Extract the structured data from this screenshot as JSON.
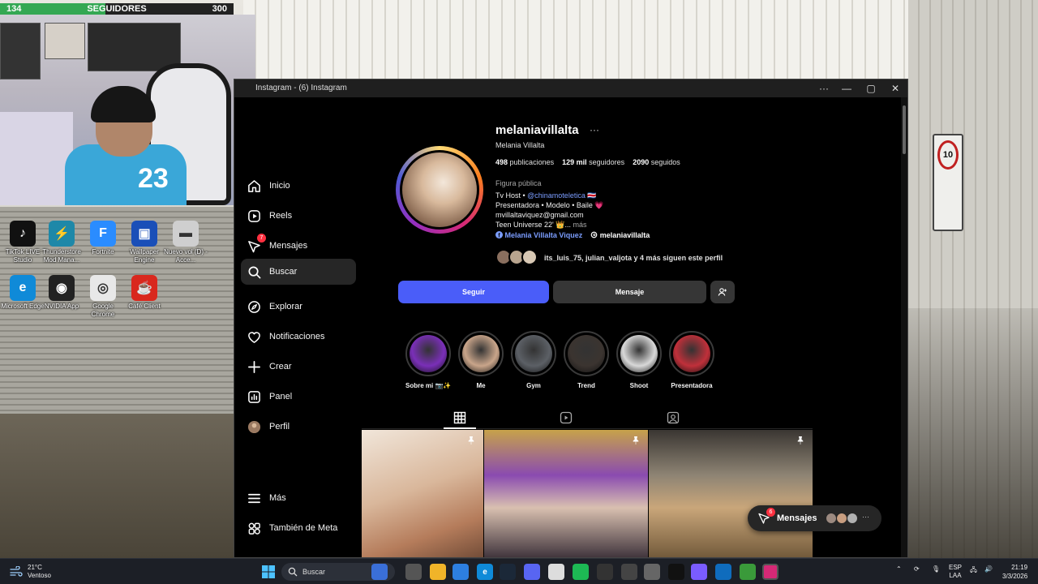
{
  "stream_overlay": {
    "follow_goal": {
      "current": "134",
      "label": "SEGUIDORES",
      "target": "300",
      "progress_fraction": 0.45
    }
  },
  "desktop_icons": [
    {
      "label": "TikTok LIVE Studio",
      "icon": "tiktok-live-icon",
      "color": "#111111"
    },
    {
      "label": "Thunderstore Mod Mana...",
      "icon": "thunderstore-icon",
      "color": "#1e88a8"
    },
    {
      "label": "Fortnite",
      "icon": "fortnite-icon",
      "color": "#2a8cff"
    },
    {
      "label": "Wallpaper Engine",
      "icon": "wallpaper-engine-icon",
      "color": "#1a4fb8"
    },
    {
      "label": "Nuevo vol (D) - Acce...",
      "icon": "drive-icon",
      "color": "#cfcfcf"
    },
    {
      "label": "Microsoft Edge",
      "icon": "edge-icon",
      "color": "#0f8ad8"
    },
    {
      "label": "NVIDIA App",
      "icon": "nvidia-icon",
      "color": "#222222"
    },
    {
      "label": "Google Chrome",
      "icon": "chrome-icon",
      "color": "#e8e8e8"
    },
    {
      "label": "Café Client",
      "icon": "cafe-client-icon",
      "color": "#d9281e"
    }
  ],
  "window": {
    "title": "Instagram - (6) Instagram",
    "controls": [
      "···",
      "—",
      "▢",
      "✕"
    ]
  },
  "sidebar": {
    "items": [
      {
        "label": "Inicio",
        "icon": "home-icon"
      },
      {
        "label": "Reels",
        "icon": "reels-icon"
      },
      {
        "label": "Mensajes",
        "icon": "messages-icon",
        "badge": "7"
      },
      {
        "label": "Buscar",
        "icon": "search-icon",
        "active": true
      },
      {
        "label": "Explorar",
        "icon": "explore-icon"
      },
      {
        "label": "Notificaciones",
        "icon": "heart-icon"
      },
      {
        "label": "Crear",
        "icon": "plus-icon"
      },
      {
        "label": "Panel",
        "icon": "dashboard-icon"
      },
      {
        "label": "Perfil",
        "icon": "profile-avatar-icon"
      }
    ],
    "bottom_items": [
      {
        "label": "Más",
        "icon": "menu-icon"
      },
      {
        "label": "También de Meta",
        "icon": "meta-apps-icon"
      }
    ]
  },
  "profile": {
    "username": "melaniavillalta",
    "more": "···",
    "full_name": "Melania Villalta",
    "posts_count": "498",
    "posts_label": "publicaciones",
    "followers_count": "129 mil",
    "followers_label": "seguidores",
    "following_count": "2090",
    "following_label": "seguidos",
    "category": "Figura pública",
    "bio_line1_prefix": "Tv Host • ",
    "bio_line1_mention": "@chinamoteletica",
    "bio_line1_suffix": " 🇨🇷",
    "bio_line2": "Presentadora • Modelo • Baile 💗",
    "bio_line3": "mvillaltaviquez@gmail.com",
    "bio_line4": "Teen Universe 22' 👑...",
    "bio_more": "más",
    "facebook_link": "Melania Villalta Viquez",
    "threads_link": "melaniavillalta",
    "followed_by": "its_luis_75, julian_valjota y 4 más siguen este perfil"
  },
  "buttons": {
    "follow": "Seguir",
    "message": "Mensaje"
  },
  "highlights": [
    {
      "label": "Sobre mi 📷✨",
      "color": "#7a2fb8"
    },
    {
      "label": "Me",
      "color": "#c9a58a"
    },
    {
      "label": "Gym",
      "color": "#5c6066"
    },
    {
      "label": "Trend",
      "color": "#3b3430"
    },
    {
      "label": "Shoot",
      "color": "#d8d8d8"
    },
    {
      "label": "Presentadora",
      "color": "#c0303a"
    }
  ],
  "tabs": [
    {
      "icon": "grid-icon",
      "active": true
    },
    {
      "icon": "reels-tab-icon",
      "active": false
    },
    {
      "icon": "tagged-icon",
      "active": false
    }
  ],
  "posts": [
    {
      "pinned": true,
      "color": "#d9c2a8"
    },
    {
      "pinned": true,
      "color": "#7a4f9a"
    },
    {
      "pinned": true,
      "color": "#a89070"
    }
  ],
  "messages_pill": {
    "label": "Mensajes",
    "badge": "6",
    "more": "···"
  },
  "taskbar": {
    "weather_temp": "21°C",
    "weather_desc": "Ventoso",
    "search_placeholder": "Buscar",
    "lang_line1": "ESP",
    "lang_line2": "LAA",
    "time": "21:19",
    "date": "3/3/2026"
  }
}
